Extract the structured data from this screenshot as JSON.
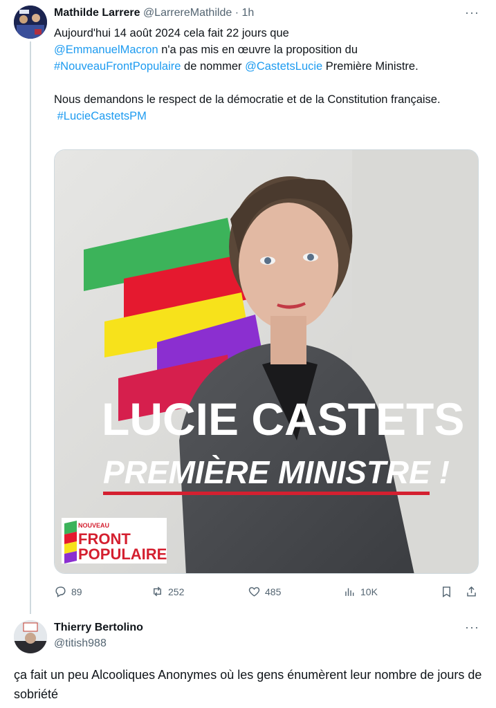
{
  "tweet": {
    "author_name": "Mathilde Larrere",
    "author_handle": "@LarrereMathilde",
    "separator": "·",
    "time": "1h",
    "more_label": "···",
    "line1": "Aujourd'hui 14 août 2024 cela fait 22 jours que",
    "mention_macron": "@EmmanuelMacron",
    "line2_rest": " n'a pas mis en œuvre la proposition du",
    "hashtag_nfp": "#NouveauFrontPopulaire",
    "line3_mid": " de nommer ",
    "mention_castets": "@CastetsLucie",
    "line3_end": " Première Ministre.",
    "para2": "Nous demandons le respect de la démocratie et de la Constitution française.",
    "hashtag_pm": "#LucieCastetsPM",
    "image": {
      "headline_name": "LUCIE CASTETS",
      "headline_title": "PREMIÈRE MINISTRE !",
      "logo_top": "NOUVEAU",
      "logo_mid": "FRONT",
      "logo_bottom": "POPULAIRE",
      "colors": {
        "green": "#3cb35a",
        "red": "#e5192f",
        "yellow": "#f7e21b",
        "purple": "#8b2fd0",
        "crimson": "#d61f4d",
        "underline": "#d42030"
      }
    },
    "actions": {
      "replies": "89",
      "retweets": "252",
      "likes": "485",
      "views": "10K"
    }
  },
  "reply": {
    "author_name": "Thierry Bertolino",
    "author_handle": "@titish988",
    "more_label": "···",
    "text": "ça fait un peu Alcooliques Anonymes où les gens énumèrent leur nombre de jours de sobriété"
  },
  "icons": [
    "reply-icon",
    "retweet-icon",
    "like-icon",
    "views-icon",
    "bookmark-icon",
    "share-icon",
    "more-icon"
  ]
}
